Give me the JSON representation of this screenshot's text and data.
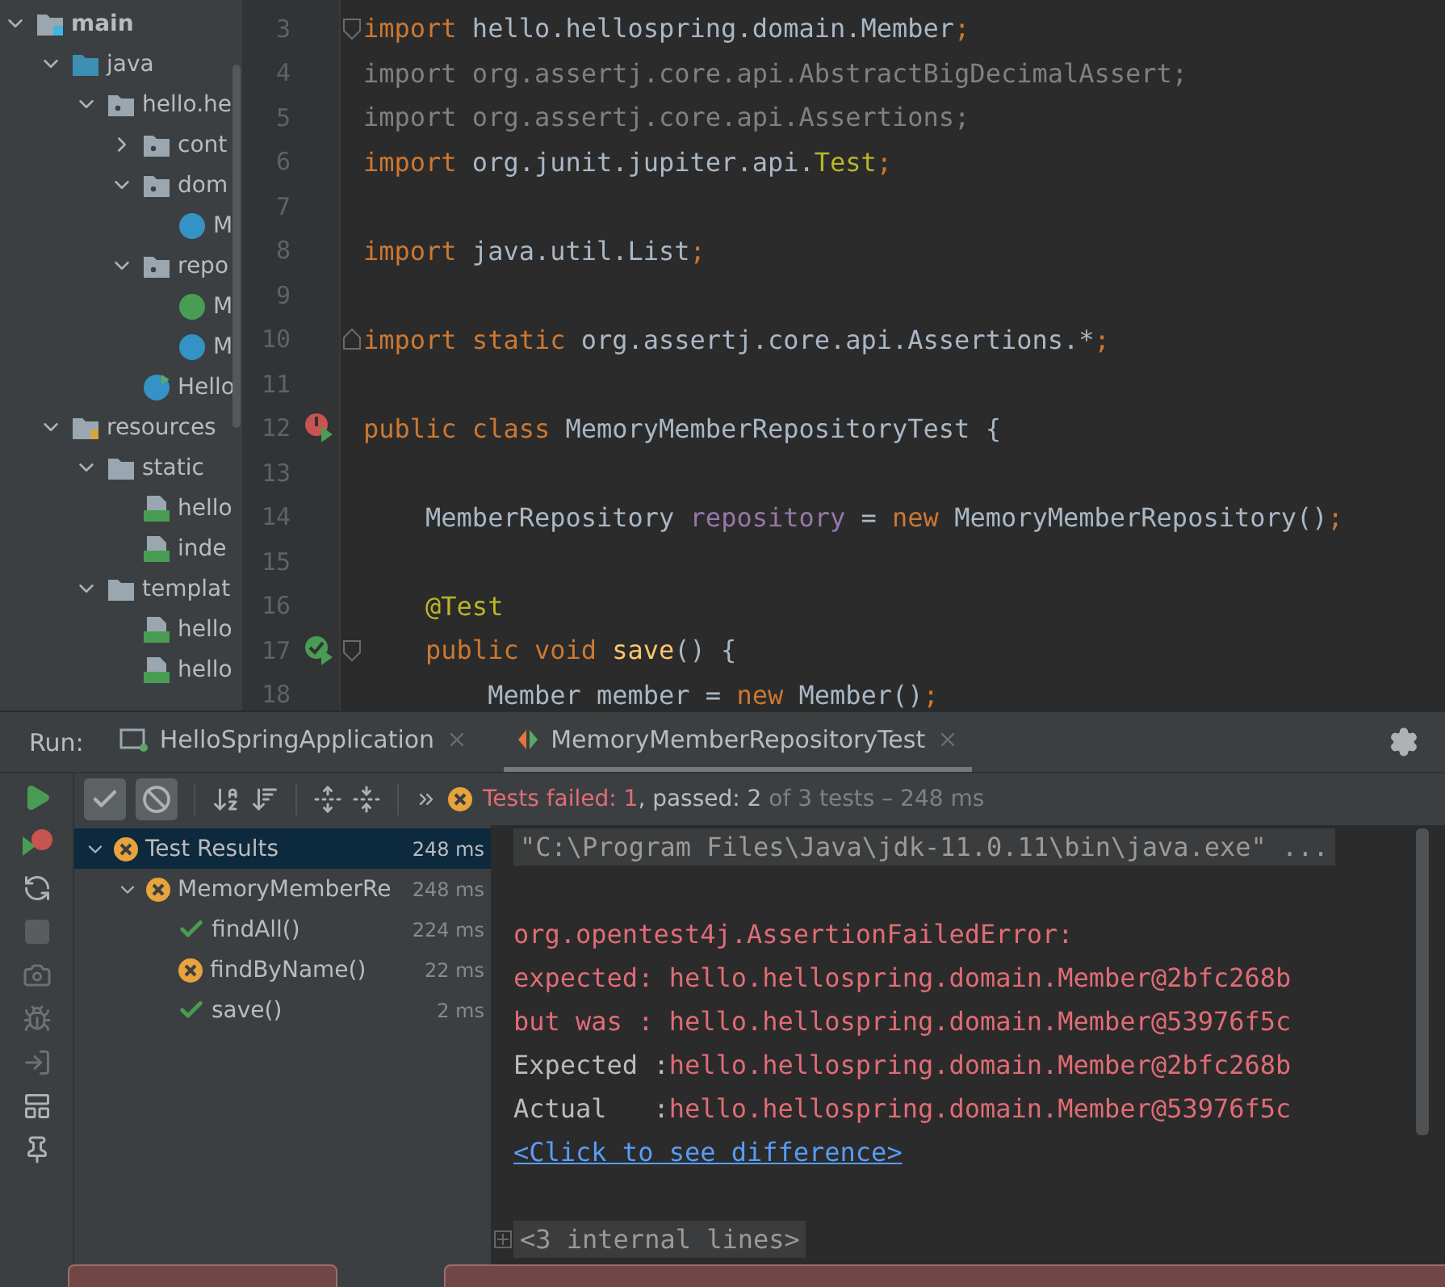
{
  "project_tree": [
    {
      "label": "main",
      "kind": "source-set",
      "expanded": true,
      "children": [
        {
          "label": "java",
          "kind": "source-root",
          "expanded": true,
          "children": [
            {
              "label": "hello.he",
              "kind": "package",
              "expanded": true,
              "children": [
                {
                  "label": "cont",
                  "kind": "package",
                  "expanded": false
                },
                {
                  "label": "dom",
                  "kind": "package",
                  "expanded": true,
                  "children": [
                    {
                      "label": "M",
                      "kind": "class"
                    }
                  ]
                },
                {
                  "label": "repo",
                  "kind": "package",
                  "expanded": true,
                  "children": [
                    {
                      "label": "M",
                      "kind": "interface"
                    },
                    {
                      "label": "M",
                      "kind": "class"
                    }
                  ]
                },
                {
                  "label": "Hello",
                  "kind": "app-class"
                }
              ]
            }
          ]
        },
        {
          "label": "resources",
          "kind": "resources",
          "expanded": true,
          "children": [
            {
              "label": "static",
              "kind": "folder",
              "expanded": true,
              "children": [
                {
                  "label": "hello",
                  "kind": "html"
                },
                {
                  "label": "inde",
                  "kind": "html"
                }
              ]
            },
            {
              "label": "templat",
              "kind": "folder",
              "expanded": true,
              "children": [
                {
                  "label": "hello",
                  "kind": "html"
                },
                {
                  "label": "hello",
                  "kind": "html"
                }
              ]
            }
          ]
        }
      ]
    }
  ],
  "editor": {
    "lines": [
      {
        "n": "3",
        "kind": "plain",
        "fold_start": true,
        "tokens": [
          {
            "t": "import",
            "kind": "keyword"
          },
          {
            "t": " hello.hellospring.domain.Member",
            "kind": "plain"
          },
          {
            "t": ";",
            "kind": "keyword"
          }
        ]
      },
      {
        "n": "4",
        "kind": "plain",
        "tokens": [
          {
            "t": "import org.assertj.core.api.AbstractBigDecimalAssert;",
            "kind": "unused"
          }
        ]
      },
      {
        "n": "5",
        "kind": "plain",
        "tokens": [
          {
            "t": "import org.assertj.core.api.Assertions;",
            "kind": "unused"
          }
        ]
      },
      {
        "n": "6",
        "kind": "plain",
        "tokens": [
          {
            "t": "import",
            "kind": "keyword"
          },
          {
            "t": " org.junit.jupiter.api.",
            "kind": "plain"
          },
          {
            "t": "Test",
            "kind": "annotation"
          },
          {
            "t": ";",
            "kind": "keyword"
          }
        ]
      },
      {
        "n": "7",
        "kind": "plain"
      },
      {
        "n": "8",
        "kind": "plain",
        "tokens": [
          {
            "t": "import",
            "kind": "keyword"
          },
          {
            "t": " java.util.List",
            "kind": "plain"
          },
          {
            "t": ";",
            "kind": "keyword"
          }
        ]
      },
      {
        "n": "9",
        "kind": "plain"
      },
      {
        "n": "10",
        "kind": "plain",
        "fold_end": true,
        "tokens": [
          {
            "t": "import static",
            "kind": "keyword"
          },
          {
            "t": " org.assertj.core.api.Assertions.*",
            "kind": "plain"
          },
          {
            "t": ";",
            "kind": "keyword"
          }
        ]
      },
      {
        "n": "11",
        "kind": "plain"
      },
      {
        "n": "12",
        "kind": "test-failed",
        "tokens": [
          {
            "t": "public class",
            "kind": "keyword"
          },
          {
            "t": " MemoryMemberRepositoryTest {",
            "kind": "plain"
          }
        ]
      },
      {
        "n": "13",
        "kind": "plain"
      },
      {
        "n": "14",
        "kind": "plain",
        "tokens": [
          {
            "t": "    MemberRepository ",
            "kind": "plain"
          },
          {
            "t": "repository",
            "kind": "field"
          },
          {
            "t": " = ",
            "kind": "plain"
          },
          {
            "t": "new",
            "kind": "keyword"
          },
          {
            "t": " MemoryMemberRepository()",
            "kind": "plain"
          },
          {
            "t": ";",
            "kind": "keyword"
          }
        ]
      },
      {
        "n": "15",
        "kind": "plain"
      },
      {
        "n": "16",
        "kind": "plain",
        "tokens": [
          {
            "t": "    @Test",
            "kind": "annotation"
          }
        ]
      },
      {
        "n": "17",
        "kind": "test-passed",
        "fold_start": true,
        "tokens": [
          {
            "t": "    public void ",
            "kind": "keyword"
          },
          {
            "t": "save",
            "kind": "method"
          },
          {
            "t": "() {",
            "kind": "plain"
          }
        ]
      },
      {
        "n": "18",
        "kind": "plain",
        "tokens": [
          {
            "t": "        Member member = ",
            "kind": "plain"
          },
          {
            "t": "new",
            "kind": "keyword"
          },
          {
            "t": " Member()",
            "kind": "plain"
          },
          {
            "t": ";",
            "kind": "keyword"
          }
        ]
      }
    ]
  },
  "run_panel": {
    "label": "Run:",
    "tabs": [
      {
        "label": "HelloSpringApplication",
        "kind": "app",
        "selected": false
      },
      {
        "label": "MemoryMemberRepositoryTest",
        "kind": "test",
        "selected": true
      }
    ],
    "toolbar": {
      "show_passed": true,
      "show_ignored": true
    },
    "status": [
      {
        "t": "Tests failed: 1",
        "kind": "fail"
      },
      {
        "t": ", passed: 2",
        "kind": "normal"
      },
      {
        "t": " of 3 tests – 248 ms",
        "kind": "muted"
      }
    ],
    "tests": [
      {
        "name": "Test Results",
        "time": "248 ms",
        "kind": "failed",
        "selected": true,
        "expanded": true,
        "children": [
          {
            "name": "MemoryMemberRe",
            "time": "248 ms",
            "kind": "failed",
            "selected": false,
            "expanded": true,
            "children": [
              {
                "name": "findAll()",
                "time": "224 ms",
                "kind": "passed",
                "selected": false
              },
              {
                "name": "findByName()",
                "time": "22 ms",
                "kind": "failed",
                "selected": false
              },
              {
                "name": "save()",
                "time": "2 ms",
                "kind": "passed",
                "selected": false
              }
            ]
          }
        ]
      }
    ],
    "console": [
      {
        "kind": "command",
        "t": "\"C:\\Program Files\\Java\\jdk-11.0.11\\bin\\java.exe\" ..."
      },
      {
        "kind": "blank"
      },
      {
        "kind": "error",
        "t": "org.opentest4j.AssertionFailedError:"
      },
      {
        "kind": "error",
        "t": "expected: hello.hellospring.domain.Member@2bfc268b"
      },
      {
        "kind": "error",
        "t": "but was : hello.hellospring.domain.Member@53976f5c"
      },
      {
        "kind": "pair",
        "label": "Expected :",
        "value": "hello.hellospring.domain.Member@2bfc268b"
      },
      {
        "kind": "pair",
        "label": "Actual   :",
        "value": "hello.hellospring.domain.Member@53976f5c"
      },
      {
        "kind": "link",
        "t": "<Click to see difference>"
      },
      {
        "kind": "blank"
      },
      {
        "kind": "folded",
        "t": "<3 internal lines>"
      }
    ]
  }
}
